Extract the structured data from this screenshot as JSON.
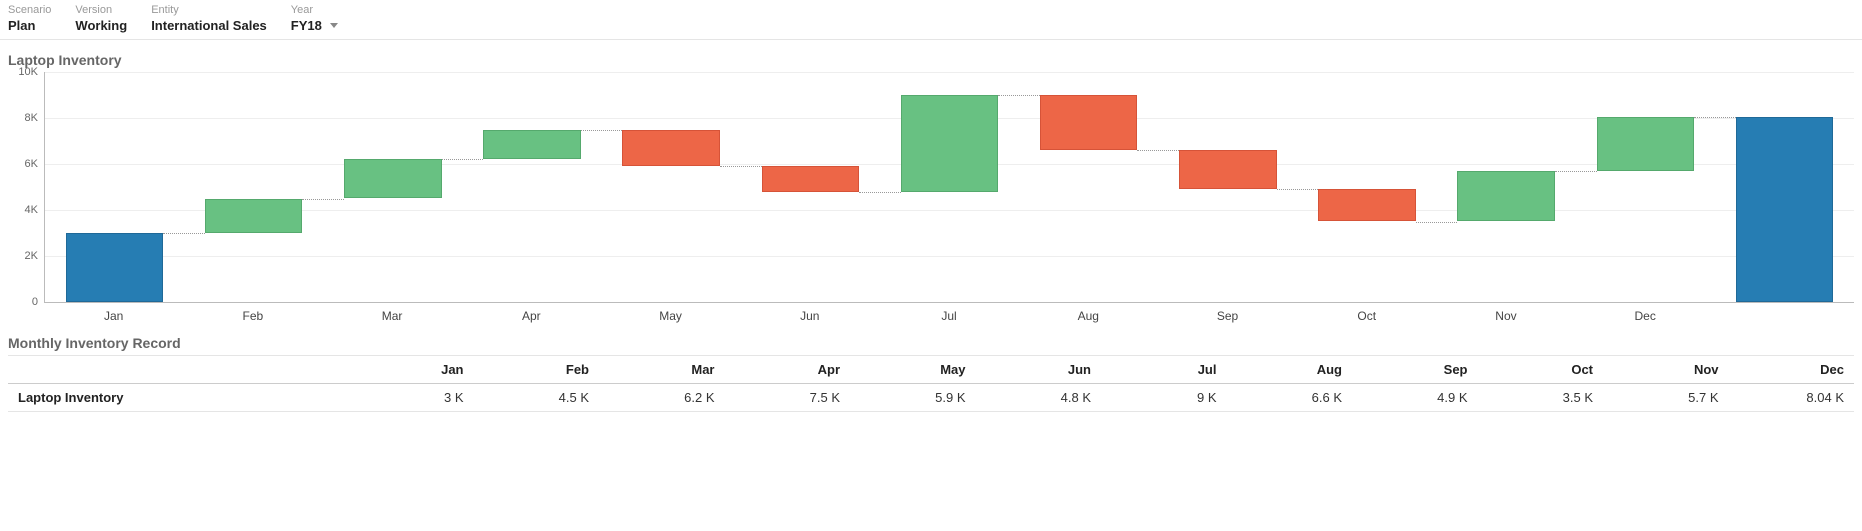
{
  "pov": {
    "items": [
      {
        "label": "Scenario",
        "value": "Plan",
        "dropdown": false
      },
      {
        "label": "Version",
        "value": "Working",
        "dropdown": false
      },
      {
        "label": "Entity",
        "value": "International Sales",
        "dropdown": false
      },
      {
        "label": "Year",
        "value": "FY18",
        "dropdown": true
      }
    ]
  },
  "chart_title": "Laptop Inventory",
  "table_title": "Monthly Inventory Record",
  "table": {
    "row_label": "Laptop Inventory",
    "columns": [
      "Jan",
      "Feb",
      "Mar",
      "Apr",
      "May",
      "Jun",
      "Jul",
      "Aug",
      "Sep",
      "Oct",
      "Nov",
      "Dec"
    ],
    "cells": [
      "3 K",
      "4.5 K",
      "6.2 K",
      "7.5 K",
      "5.9 K",
      "4.8 K",
      "9 K",
      "6.6 K",
      "4.9 K",
      "3.5 K",
      "5.7 K",
      "8.04 K"
    ]
  },
  "chart_data": {
    "type": "waterfall",
    "title": "Laptop Inventory",
    "ylabel": "",
    "xlabel": "",
    "ylim": [
      0,
      10000
    ],
    "y_ticks": [
      0,
      2000,
      4000,
      6000,
      8000,
      10000
    ],
    "y_tick_labels": [
      "0",
      "2K",
      "4K",
      "6K",
      "8K",
      "10K"
    ],
    "categories": [
      "Jan",
      "Feb",
      "Mar",
      "Apr",
      "May",
      "Jun",
      "Jul",
      "Aug",
      "Sep",
      "Oct",
      "Nov",
      "Dec",
      ""
    ],
    "colors": {
      "start_end": "#267db3",
      "increase": "#68c182",
      "decrease": "#ed6647"
    },
    "bars": [
      {
        "cat": "Jan",
        "low": 0,
        "high": 3000,
        "kind": "start",
        "color": "blue"
      },
      {
        "cat": "Feb",
        "low": 3000,
        "high": 4500,
        "kind": "increase",
        "color": "green"
      },
      {
        "cat": "Mar",
        "low": 4500,
        "high": 6200,
        "kind": "increase",
        "color": "green"
      },
      {
        "cat": "Apr",
        "low": 6200,
        "high": 7500,
        "kind": "increase",
        "color": "green"
      },
      {
        "cat": "May",
        "low": 5900,
        "high": 7500,
        "kind": "decrease",
        "color": "orange"
      },
      {
        "cat": "Jun",
        "low": 4800,
        "high": 5900,
        "kind": "decrease",
        "color": "orange"
      },
      {
        "cat": "Jul",
        "low": 4800,
        "high": 9000,
        "kind": "increase",
        "color": "green"
      },
      {
        "cat": "Aug",
        "low": 6600,
        "high": 9000,
        "kind": "decrease",
        "color": "orange"
      },
      {
        "cat": "Sep",
        "low": 4900,
        "high": 6600,
        "kind": "decrease",
        "color": "orange"
      },
      {
        "cat": "Oct",
        "low": 3500,
        "high": 4900,
        "kind": "decrease",
        "color": "orange"
      },
      {
        "cat": "Nov",
        "low": 3500,
        "high": 5700,
        "kind": "increase",
        "color": "green"
      },
      {
        "cat": "Dec",
        "low": 5700,
        "high": 8040,
        "kind": "increase",
        "color": "green"
      },
      {
        "cat": "",
        "low": 0,
        "high": 8040,
        "kind": "end",
        "color": "blue"
      }
    ]
  }
}
